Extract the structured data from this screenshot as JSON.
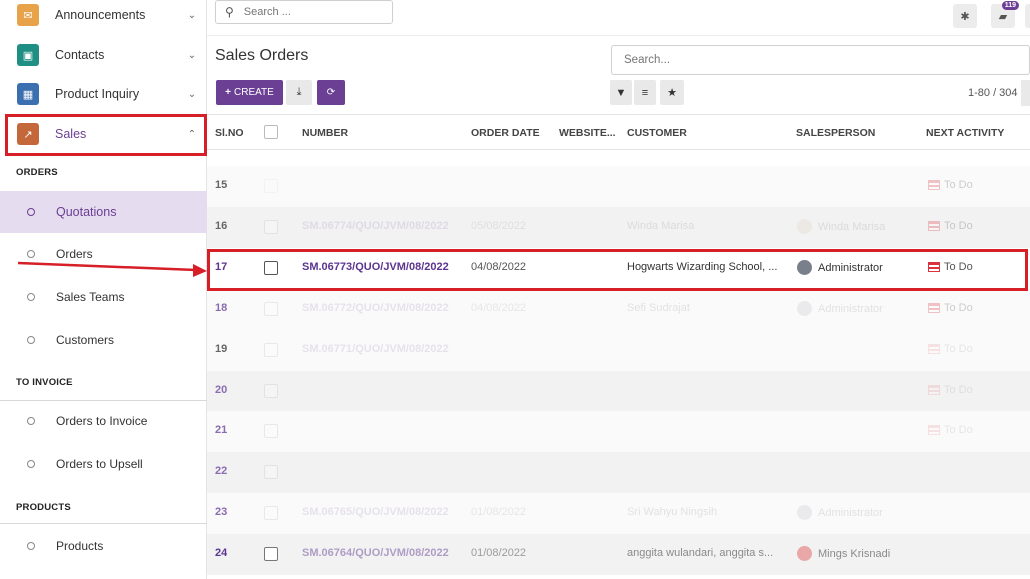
{
  "sidebar": {
    "apps": [
      {
        "label": "Announcements",
        "icon": "megaphone-icon",
        "chevron": "⌄"
      },
      {
        "label": "Contacts",
        "icon": "contact-card-icon",
        "chevron": "⌄"
      },
      {
        "label": "Product Inquiry",
        "icon": "product-box-icon",
        "chevron": "⌄"
      },
      {
        "label": "Sales",
        "icon": "sales-chart-icon",
        "chevron": "⌃"
      }
    ],
    "sections": [
      {
        "title": "ORDERS",
        "items": [
          "Quotations",
          "Orders",
          "Sales Teams",
          "Customers"
        ]
      },
      {
        "title": "TO INVOICE",
        "items": [
          "Orders to Invoice",
          "Orders to Upsell"
        ]
      },
      {
        "title": "PRODUCTS",
        "items": [
          "Products"
        ]
      }
    ],
    "active_item": "Quotations"
  },
  "topbar": {
    "search_placeholder": "Search ...",
    "messages_badge": "119",
    "colors": {
      "accent": "#6b3f94"
    }
  },
  "page": {
    "title": "Sales Orders",
    "search_placeholder": "Search...",
    "create_label": "CREATE",
    "pager": "1-80 / 304"
  },
  "table": {
    "columns": [
      "Sl.NO",
      "NUMBER",
      "ORDER DATE",
      "WEBSITE...",
      "CUSTOMER",
      "SALESPERSON",
      "NEXT ACTIVITY"
    ],
    "rows": [
      {
        "sl": "15",
        "number": "",
        "date": "",
        "customer": "",
        "salesperson": "",
        "activity": "To Do"
      },
      {
        "sl": "16",
        "number": "SM.06774/QUO/JVM/08/2022",
        "date": "05/08/2022",
        "customer": "Winda Marisa",
        "salesperson": "Winda Marisa",
        "activity": "To Do"
      },
      {
        "sl": "17",
        "number": "SM.06773/QUO/JVM/08/2022",
        "date": "04/08/2022",
        "customer": "Hogwarts Wizarding School, ...",
        "salesperson": "Administrator",
        "activity": "To Do"
      },
      {
        "sl": "18",
        "number": "SM.06772/QUO/JVM/08/2022",
        "date": "04/08/2022",
        "customer": "Sefi Sudrajat",
        "salesperson": "Administrator",
        "activity": "To Do"
      },
      {
        "sl": "19",
        "number": "SM.06771/QUO/JVM/08/2022",
        "date": "",
        "customer": "",
        "salesperson": "",
        "activity": "To Do"
      },
      {
        "sl": "20",
        "number": "",
        "date": "",
        "customer": "",
        "salesperson": "",
        "activity": "To Do"
      },
      {
        "sl": "21",
        "number": "",
        "date": "",
        "customer": "",
        "salesperson": "",
        "activity": "To Do"
      },
      {
        "sl": "22",
        "number": "",
        "date": "",
        "customer": "",
        "salesperson": "",
        "activity": ""
      },
      {
        "sl": "23",
        "number": "SM.06765/QUO/JVM/08/2022",
        "date": "01/08/2022",
        "customer": "Sri Wahyu Ningsih",
        "salesperson": "Administrator",
        "activity": ""
      },
      {
        "sl": "24",
        "number": "SM.06764/QUO/JVM/08/2022",
        "date": "01/08/2022",
        "customer": "anggita wulandari, anggita s...",
        "salesperson": "Mings Krisnadi",
        "activity": ""
      }
    ]
  }
}
